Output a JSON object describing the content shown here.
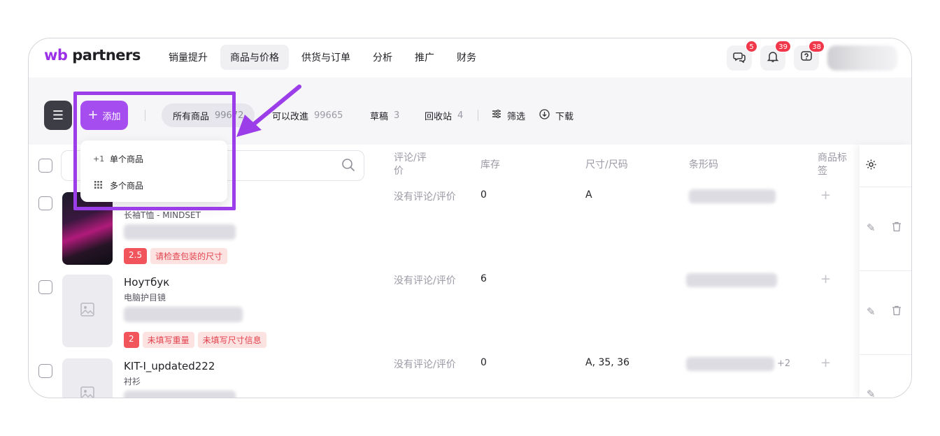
{
  "logo": {
    "brand": "wb",
    "name": "partners"
  },
  "nav": {
    "items": [
      "销量提升",
      "商品与价格",
      "供货与订单",
      "分析",
      "推广",
      "财务"
    ],
    "active_index": 1
  },
  "header_icons": [
    {
      "name": "chat-icon",
      "badge": "5"
    },
    {
      "name": "bell-icon",
      "badge": "39"
    },
    {
      "name": "help-icon",
      "badge": "38"
    }
  ],
  "toolbar": {
    "add_label": "添加",
    "tabs": [
      {
        "label": "所有商品",
        "count": "99672"
      },
      {
        "label": "可以改進",
        "count": "99665"
      },
      {
        "label": "草稿",
        "count": "3"
      },
      {
        "label": "回收站",
        "count": "4"
      }
    ],
    "filter_label": "筛选",
    "download_label": "下载"
  },
  "dropdown": {
    "items": [
      {
        "icon": "+1",
        "label": "单个商品"
      },
      {
        "icon": "grid",
        "label": "多个商品"
      }
    ]
  },
  "table": {
    "headers": {
      "reviews": "评论/评价",
      "stock": "库存",
      "size": "尺寸/尺码",
      "barcode": "条形码",
      "tags": "商品标签"
    },
    "rows": [
      {
        "title": "",
        "subtitle": "长袖T恤 - MINDSET",
        "reviews": "没有评论/评价",
        "stock": "0",
        "size": "A",
        "extra": "",
        "tags": {
          "score": "2.5",
          "warnings": [
            "请检查包装的尺寸"
          ]
        }
      },
      {
        "title": "Ноутбук",
        "subtitle": "电脑护目镜",
        "reviews": "没有评论/评价",
        "stock": "6",
        "size": "",
        "extra": "",
        "tags": {
          "score": "2",
          "warnings": [
            "未填写重量",
            "未填写尺寸信息"
          ]
        }
      },
      {
        "title": "KIT-I_updated222",
        "subtitle": "衬衫",
        "reviews": "没有评论/评价",
        "stock": "0",
        "size": "A, 35, 36",
        "extra": "+2",
        "tags": {
          "score": "",
          "warnings": []
        }
      }
    ]
  },
  "colors": {
    "accent": "#a64df0",
    "annotation": "#9b3de8",
    "badge": "#f0384a",
    "warning_bg": "#fde2e2",
    "warning_text": "#e2434d"
  }
}
